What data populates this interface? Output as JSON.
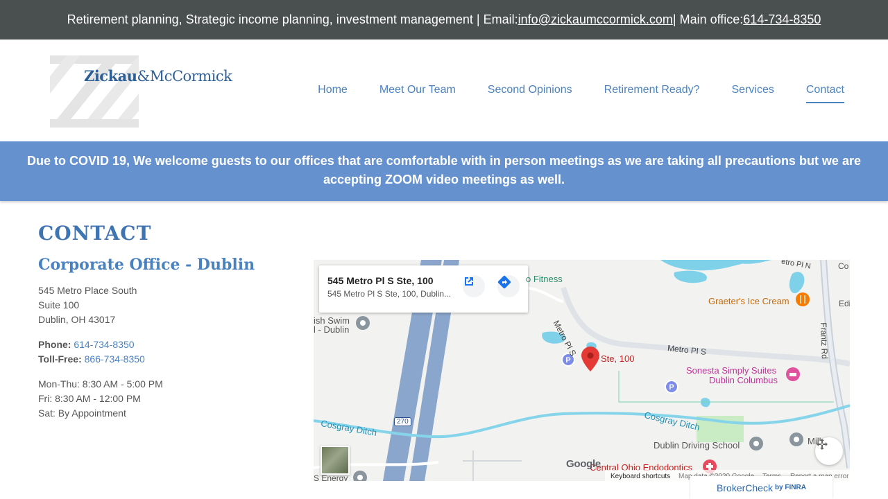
{
  "topbar": {
    "text_prefix": "Retirement planning, Strategic income planning, investment management | Email: ",
    "email": "info@zickaumccormick.com",
    "text_mid": " | Main office: ",
    "phone": "614-734-8350"
  },
  "logo": {
    "name_bold": "Zickau",
    "name_rest": "&McCormick"
  },
  "nav": {
    "items": [
      {
        "label": "Home"
      },
      {
        "label": "Meet Our Team"
      },
      {
        "label": "Second Opinions"
      },
      {
        "label": "Retirement Ready?"
      },
      {
        "label": "Services"
      },
      {
        "label": "Contact"
      }
    ],
    "active": "Contact"
  },
  "banner": {
    "text": "Due to COVID 19, We welcome guests to our offices that are comfortable with in person meetings as we are taking all precautions but we are accepting ZOOM video meetings as well."
  },
  "contact": {
    "title": "CONTACT",
    "office_title": "Corporate Office - Dublin",
    "address": [
      "545 Metro Place South",
      "Suite 100",
      "Dublin, OH 43017"
    ],
    "phone_label": "Phone:",
    "phone": "614-734-8350",
    "tollfree_label": "Toll-Free:",
    "tollfree": "866-734-8350",
    "hours": [
      "Mon-Thu: 8:30 AM - 5:00 PM",
      "Fri: 8:30 AM - 12:00 PM",
      "Sat: By Appointment"
    ]
  },
  "map": {
    "card_title": "545 Metro Pl S Ste, 100",
    "card_subtitle": "545 Metro Pl S Ste, 100, Dublin...",
    "pin_label": "Ste, 100",
    "labels": {
      "fitness": "o Fitness",
      "graeters": "Graeter's Ice Cream",
      "sonesta1": "Sonesta Simply Suites",
      "sonesta2": "Dublin Columbus",
      "swim1": "ish Swim",
      "swim2": "l - Dublin",
      "metro1": "Metro Pl S",
      "metro2": "Metro Pl S",
      "frantz": "Frantz Rd",
      "cosgray1": "Cosgray Ditch",
      "cosgray2": "Cosgray Ditch",
      "driving": "Dublin Driving School",
      "endo": "Central Ohio Endodontics",
      "energy": "S Energy",
      "mill": "Mill",
      "edi": "Edi",
      "co": "Co",
      "metro_n": "etro Pl N",
      "i270": "270",
      "google": "Google"
    },
    "footer": {
      "shortcuts": "Keyboard shortcuts",
      "mapdata": "Map data ©2020 Google",
      "terms": "Terms",
      "report": "Report a map error"
    }
  },
  "brokercheck": {
    "label": "BrokerCheck",
    "by": "by FINRA"
  },
  "colors": {
    "topbar_bg": "#4a4f4f",
    "banner_bg": "#6592cf",
    "link": "#4a82c0",
    "heading": "#3f74b3"
  }
}
